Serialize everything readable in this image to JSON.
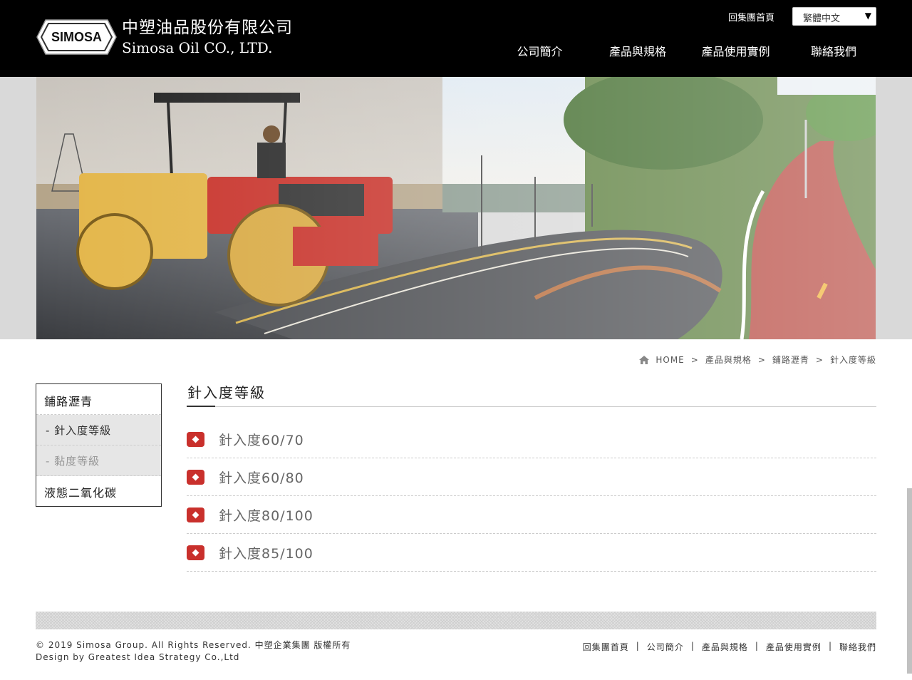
{
  "brand": {
    "logo_mark": "SIMOSA",
    "name_cn": "中塑油品股份有限公司",
    "name_en": "Simosa Oil CO., LTD."
  },
  "header": {
    "group_home": "回集團首頁",
    "language": "繁體中文",
    "language_arrow": "▼",
    "nav": [
      "公司簡介",
      "產品與規格",
      "產品使用實例",
      "聯絡我們"
    ]
  },
  "breadcrumb": {
    "home": "HOME",
    "separator": ">",
    "items": [
      "產品與規格",
      "鋪路瀝青",
      "針入度等級"
    ]
  },
  "sidebar": {
    "category": "鋪路瀝青",
    "subitems": [
      {
        "label": "- 針入度等級",
        "active": true
      },
      {
        "label": "- 黏度等級",
        "active": false
      }
    ],
    "other_category": "液態二氧化碳"
  },
  "content": {
    "title": "針入度等級",
    "items": [
      "針入度60/70",
      "針入度60/80",
      "針入度80/100",
      "針入度85/100"
    ]
  },
  "footer": {
    "copyright_line1": "© 2019 Simosa Group. All Rights Reserved. 中塑企業集團 版權所有",
    "copyright_line2": "Design by Greatest Idea Strategy Co.,Ltd",
    "separator": "|",
    "nav": [
      "回集團首頁",
      "公司簡介",
      "產品與規格",
      "產品使用實例",
      "聯絡我們"
    ]
  },
  "colors": {
    "header_bg": "#000000",
    "accent_red": "#c9302c",
    "sidebar_sub_bg": "#e6e6e6"
  }
}
